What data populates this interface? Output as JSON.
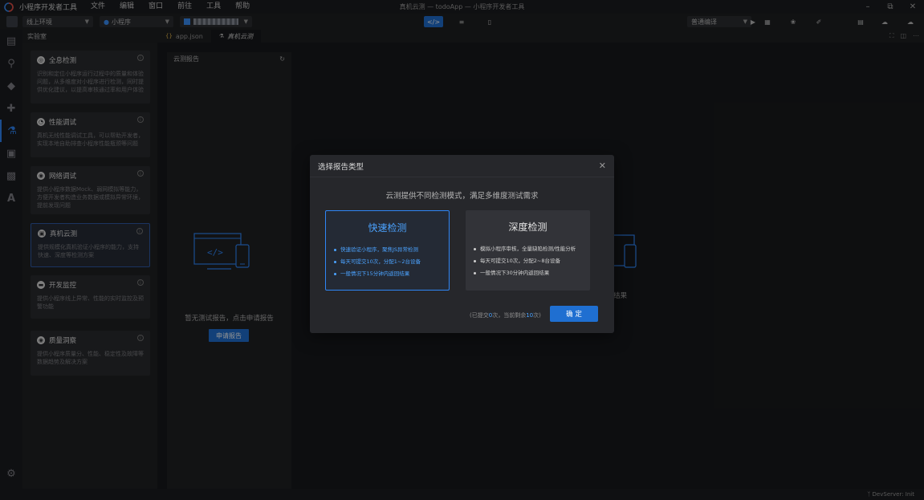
{
  "titlebar": {
    "app_name": "小程序开发者工具",
    "menus": [
      "文件",
      "编辑",
      "窗口",
      "前往",
      "工具",
      "帮助"
    ],
    "window_title": "真机云测 — todoApp — 小程序开发者工具",
    "controls": [
      "minimize-icon",
      "restore-icon",
      "close-icon"
    ]
  },
  "toolbar": {
    "env_select": "线上环境",
    "mode_select": "小程序",
    "compile_select": "普通编译",
    "view_buttons": [
      "code-icon",
      "sliders-icon",
      "device-icon"
    ]
  },
  "lab": {
    "header": "实验室",
    "cards": [
      {
        "title": "全息检测",
        "desc": "识别和定位小程序运行过程中的质量和体验问题，从多维度对小程序进行检测，同时提供优化建议，以提高审核通过率和用户体验",
        "icon": "radar-icon"
      },
      {
        "title": "性能调试",
        "desc": "真机无线性能调试工具，可以帮助开发者，实现本地自助排查小程序性能瓶颈等问题",
        "icon": "gauge-icon"
      },
      {
        "title": "网络调试",
        "desc": "提供小程序数据Mock、弱网模拟等能力，方便开发者构造业务数据或模拟异常环境，提前发现问题",
        "icon": "globe-icon"
      },
      {
        "title": "真机云测",
        "desc": "提供规模化真机验证小程序的能力，支持快速、深度等检测方案",
        "icon": "device-cloud-icon"
      },
      {
        "title": "开发监控",
        "desc": "提供小程序线上异常、性能的实时监控及预警功能",
        "icon": "monitor-icon"
      },
      {
        "title": "质量洞察",
        "desc": "提供小程序质量分、性能、稳定性及故障等数据趋势及解决方案",
        "icon": "insight-icon"
      }
    ]
  },
  "editor": {
    "tabs": [
      {
        "label": "app.json",
        "icon": "json-icon"
      },
      {
        "label": "真机云测",
        "icon": "lab-icon"
      }
    ]
  },
  "report": {
    "header": "云测报告",
    "empty_text": "暂无测试报告，点击申请报告",
    "apply_button": "申请报告",
    "bg_right_fragment": "结果"
  },
  "modal": {
    "title": "选择报告类型",
    "subtitle": "云测提供不同检测模式，满足多维度测试需求",
    "options": [
      {
        "title": "快速检测",
        "items": [
          "快速验证小程序，聚焦JS异常检测",
          "每天可提交10次，分配1~2台设备",
          "一般情况下15分钟内返回结果"
        ],
        "selected": true
      },
      {
        "title": "深度检测",
        "items": [
          "模拟小程序审核，全量缺陷检测/性能分析",
          "每天可提交10次，分配2~8台设备",
          "一般情况下30分钟内返回结果"
        ],
        "selected": false
      }
    ],
    "foot_prefix": "(已提交",
    "foot_submitted": "0",
    "foot_middle": "次，当前剩余",
    "foot_remaining": "10",
    "foot_suffix": "次)",
    "confirm_button": "确 定"
  },
  "statusbar": {
    "right_text": "DevServer: Init"
  },
  "colors": {
    "accent": "#1f6fd1",
    "accent_text": "#4ba3ff",
    "background": "#1e1f22"
  }
}
